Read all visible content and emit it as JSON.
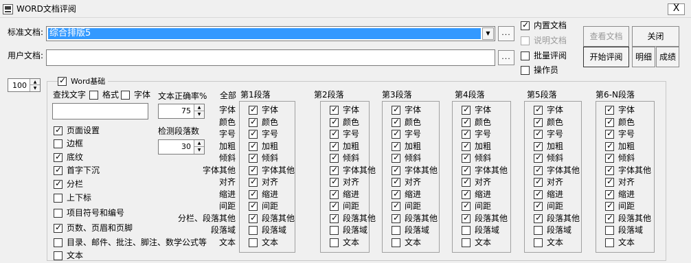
{
  "window": {
    "title": "WORD文档评阅",
    "close_label": "X"
  },
  "standard_doc": {
    "label": "标准文档:",
    "value": "综合排版5"
  },
  "user_doc": {
    "label": "用户文档:",
    "value": ""
  },
  "browse_label": "...",
  "options": {
    "builtin_doc": "内置文档",
    "explain_doc": "说明文档",
    "batch_review": "批量评阅",
    "operator": "操作员"
  },
  "buttons": {
    "view_doc": "查看文档",
    "close": "关闭",
    "start_review": "开始评阅",
    "detail": "明细",
    "score": "成绩"
  },
  "zoom_value": "100",
  "word_basics": {
    "title": "Word基础",
    "find_text": "查找文字",
    "format": "格式",
    "font": "字体",
    "accuracy_label": "文本正确率%",
    "accuracy_value": "75",
    "detect_label": "检测段落数",
    "detect_value": "30",
    "items": [
      {
        "label": "页面设置",
        "checked": true
      },
      {
        "label": "边框",
        "checked": false
      },
      {
        "label": "底纹",
        "checked": true
      },
      {
        "label": "首字下沉",
        "checked": true
      },
      {
        "label": "分栏",
        "checked": true
      },
      {
        "label": "上下标",
        "checked": false
      },
      {
        "label": "项目符号和编号",
        "checked": false
      },
      {
        "label": "页数、页眉和页脚",
        "checked": true
      },
      {
        "label": "目录、邮件、批注、脚注、数学公式等",
        "checked": false
      },
      {
        "label": "文本",
        "checked": false
      }
    ]
  },
  "all_label": "全部",
  "property_labels": [
    "字体",
    "颜色",
    "字号",
    "加粗",
    "倾斜",
    "字体其他",
    "对齐",
    "缩进",
    "间距",
    "分栏、段落其他",
    "段落域",
    "文本"
  ],
  "paragraphs": [
    {
      "title": "第1段落",
      "items": [
        {
          "label": "字体",
          "checked": true
        },
        {
          "label": "颜色",
          "checked": true
        },
        {
          "label": "字号",
          "checked": true
        },
        {
          "label": "加粗",
          "checked": true
        },
        {
          "label": "倾斜",
          "checked": true
        },
        {
          "label": "字体其他",
          "checked": true
        },
        {
          "label": "对齐",
          "checked": true
        },
        {
          "label": "缩进",
          "checked": true
        },
        {
          "label": "间距",
          "checked": true
        },
        {
          "label": "段落其他",
          "checked": true
        },
        {
          "label": "段落域",
          "checked": false
        },
        {
          "label": "文本",
          "checked": false
        }
      ]
    },
    {
      "title": "第2段落",
      "items": [
        {
          "label": "字体",
          "checked": true
        },
        {
          "label": "颜色",
          "checked": true
        },
        {
          "label": "字号",
          "checked": true
        },
        {
          "label": "加粗",
          "checked": true
        },
        {
          "label": "倾斜",
          "checked": true
        },
        {
          "label": "字体其他",
          "checked": true
        },
        {
          "label": "对齐",
          "checked": true
        },
        {
          "label": "缩进",
          "checked": true
        },
        {
          "label": "间距",
          "checked": true
        },
        {
          "label": "段落其他",
          "checked": true
        },
        {
          "label": "段落域",
          "checked": false
        },
        {
          "label": "文本",
          "checked": false
        }
      ]
    },
    {
      "title": "第3段落",
      "items": [
        {
          "label": "字体",
          "checked": true
        },
        {
          "label": "颜色",
          "checked": true
        },
        {
          "label": "字号",
          "checked": true
        },
        {
          "label": "加粗",
          "checked": true
        },
        {
          "label": "倾斜",
          "checked": true
        },
        {
          "label": "字体其他",
          "checked": true
        },
        {
          "label": "对齐",
          "checked": true
        },
        {
          "label": "缩进",
          "checked": true
        },
        {
          "label": "间距",
          "checked": true
        },
        {
          "label": "段落其他",
          "checked": true
        },
        {
          "label": "段落域",
          "checked": false
        },
        {
          "label": "文本",
          "checked": false
        }
      ]
    },
    {
      "title": "第4段落",
      "items": [
        {
          "label": "字体",
          "checked": true
        },
        {
          "label": "颜色",
          "checked": true
        },
        {
          "label": "字号",
          "checked": true
        },
        {
          "label": "加粗",
          "checked": true
        },
        {
          "label": "倾斜",
          "checked": true
        },
        {
          "label": "字体其他",
          "checked": true
        },
        {
          "label": "对齐",
          "checked": true
        },
        {
          "label": "缩进",
          "checked": true
        },
        {
          "label": "间距",
          "checked": true
        },
        {
          "label": "段落其他",
          "checked": true
        },
        {
          "label": "段落域",
          "checked": false
        },
        {
          "label": "文本",
          "checked": false
        }
      ]
    },
    {
      "title": "第5段落",
      "items": [
        {
          "label": "字体",
          "checked": true
        },
        {
          "label": "颜色",
          "checked": true
        },
        {
          "label": "字号",
          "checked": true
        },
        {
          "label": "加粗",
          "checked": true
        },
        {
          "label": "倾斜",
          "checked": true
        },
        {
          "label": "字体其他",
          "checked": true
        },
        {
          "label": "对齐",
          "checked": true
        },
        {
          "label": "缩进",
          "checked": true
        },
        {
          "label": "间距",
          "checked": true
        },
        {
          "label": "段落其他",
          "checked": true
        },
        {
          "label": "段落域",
          "checked": false
        },
        {
          "label": "文本",
          "checked": false
        }
      ]
    },
    {
      "title": "第6-N段落",
      "items": [
        {
          "label": "字体",
          "checked": true
        },
        {
          "label": "颜色",
          "checked": true
        },
        {
          "label": "字号",
          "checked": true
        },
        {
          "label": "加粗",
          "checked": true
        },
        {
          "label": "倾斜",
          "checked": true
        },
        {
          "label": "字体其他",
          "checked": true
        },
        {
          "label": "对齐",
          "checked": true
        },
        {
          "label": "缩进",
          "checked": true
        },
        {
          "label": "间距",
          "checked": true
        },
        {
          "label": "段落其他",
          "checked": true
        },
        {
          "label": "段落域",
          "checked": false
        },
        {
          "label": "文本",
          "checked": false
        }
      ]
    }
  ]
}
